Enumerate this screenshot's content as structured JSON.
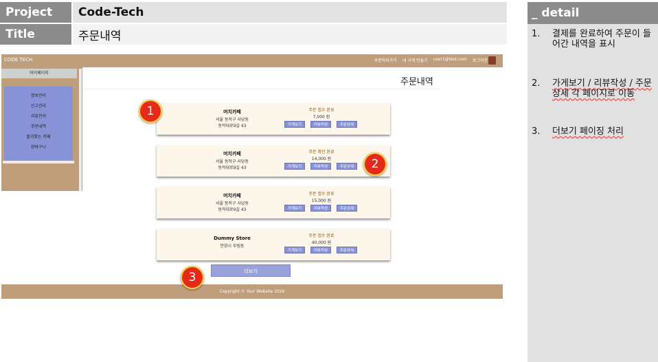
{
  "header": {
    "project_label": "Project",
    "project_value": "Code-Tech",
    "title_label": "Title",
    "title_value": "주문내역"
  },
  "detail": {
    "heading": "_ detail",
    "items": [
      {
        "num": "1.",
        "text": "결제를 완료하여 주문이 들어간 내역을 표시"
      },
      {
        "num": "2.",
        "text": "가게보기 / 리뷰작성 / 주문상세 각 페이지로 이동"
      },
      {
        "num": "3.",
        "text": "더보기 페이징 처리"
      }
    ]
  },
  "navbar": {
    "brand": "CODE TECH",
    "links": [
      "주문하러가기",
      "내 가게 만들기",
      "user1@test.com",
      "로그아웃"
    ]
  },
  "sidebar": {
    "title": "마이페이지",
    "items": [
      "정보관리",
      "신고관리",
      "리뷰관리",
      "주문내역",
      "즐겨찾는 카페",
      "장바구니"
    ]
  },
  "page": {
    "title": "주문내역",
    "more_label": "더보기",
    "footer": "Copyright © Your Website 2020"
  },
  "orders": [
    {
      "store": "머치카페",
      "addr1": "서울 동작구 사당동",
      "addr2": "동작대로9길 43",
      "status": "주문 접수 완료",
      "price": "7,000 원"
    },
    {
      "store": "머치카페",
      "addr1": "서울 동작구 사당동",
      "addr2": "동작대로9길 43",
      "status": "주문 확인 완료",
      "price": "14,000 원"
    },
    {
      "store": "머치카페",
      "addr1": "서울 동작구 사당동",
      "addr2": "동작대로9길 43",
      "status": "주문 접수 완료",
      "price": "15,000 원"
    },
    {
      "store": "Dummy Store",
      "addr1": "안양시 부림동",
      "addr2": "",
      "status": "주문 접수 완료",
      "price": "40,000 원"
    }
  ],
  "order_buttons": {
    "view_store": "가게보기",
    "write_review": "리뷰작성",
    "order_detail": "주문상세"
  },
  "markers": [
    "1",
    "2",
    "3"
  ],
  "colors": {
    "brand": "#bf9e7b",
    "accent": "#8793d6",
    "marker": "#e52a1a"
  }
}
